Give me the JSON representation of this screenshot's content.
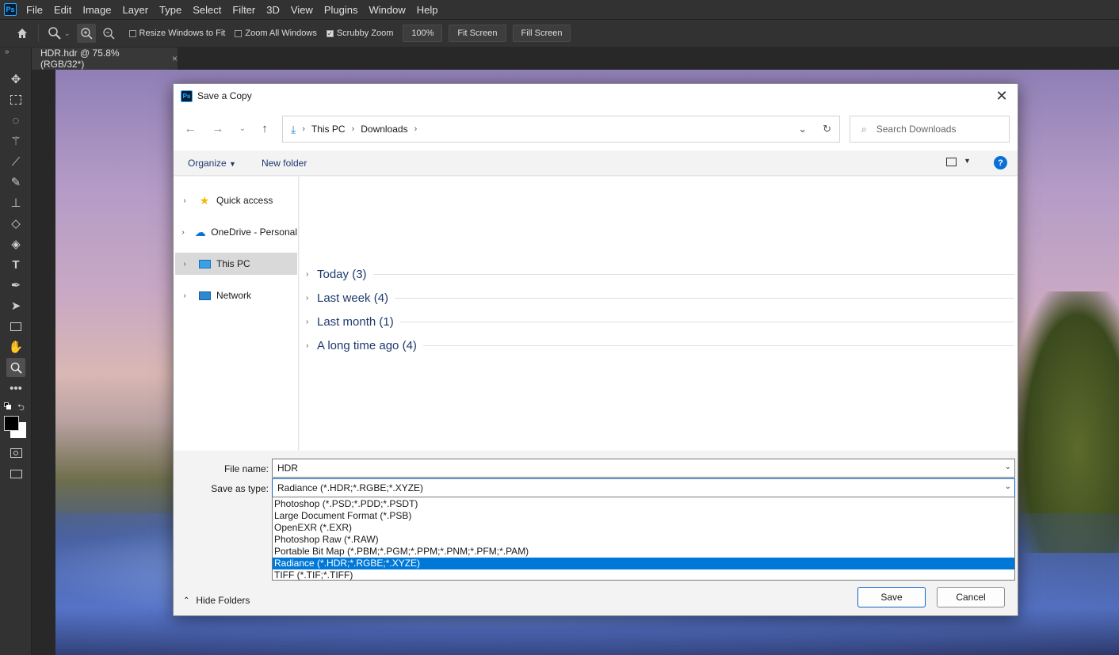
{
  "app": {
    "logo": "Ps",
    "menu": [
      "File",
      "Edit",
      "Image",
      "Layer",
      "Type",
      "Select",
      "Filter",
      "3D",
      "View",
      "Plugins",
      "Window",
      "Help"
    ]
  },
  "options": {
    "resize_windows": "Resize Windows to Fit",
    "zoom_all": "Zoom All Windows",
    "scrubby_zoom": "Scrubby Zoom",
    "zoom_value": "100%",
    "fit_screen": "Fit Screen",
    "fill_screen": "Fill Screen"
  },
  "document_tab": {
    "title": "HDR.hdr @ 75.8% (RGB/32*)",
    "close": "×"
  },
  "dialog": {
    "title": "Save a Copy",
    "logo": "Ps",
    "breadcrumb": [
      "This PC",
      "Downloads"
    ],
    "search_placeholder": "Search Downloads",
    "organize": "Organize",
    "new_folder": "New folder",
    "help": "?",
    "nav": [
      {
        "label": "Quick access",
        "icon": "star-icon"
      },
      {
        "label": "OneDrive - Personal",
        "icon": "cloud-icon"
      },
      {
        "label": "This PC",
        "icon": "computer-icon"
      },
      {
        "label": "Network",
        "icon": "network-icon"
      }
    ],
    "groups": [
      "Today (3)",
      "Last week (4)",
      "Last month (1)",
      "A long time ago (4)"
    ],
    "file_name_label": "File name:",
    "file_name_value": "HDR",
    "save_type_label": "Save as type:",
    "save_type_value": "Radiance (*.HDR;*.RGBE;*.XYZE)",
    "type_options": [
      "Photoshop (*.PSD;*.PDD;*.PSDT)",
      "Large Document Format (*.PSB)",
      "OpenEXR (*.EXR)",
      "Photoshop Raw (*.RAW)",
      "Portable Bit Map (*.PBM;*.PGM;*.PPM;*.PNM;*.PFM;*.PAM)",
      "Radiance (*.HDR;*.RGBE;*.XYZE)",
      "TIFF (*.TIF;*.TIFF)"
    ],
    "hide_folders": "Hide Folders",
    "save": "Save",
    "cancel": "Cancel"
  }
}
